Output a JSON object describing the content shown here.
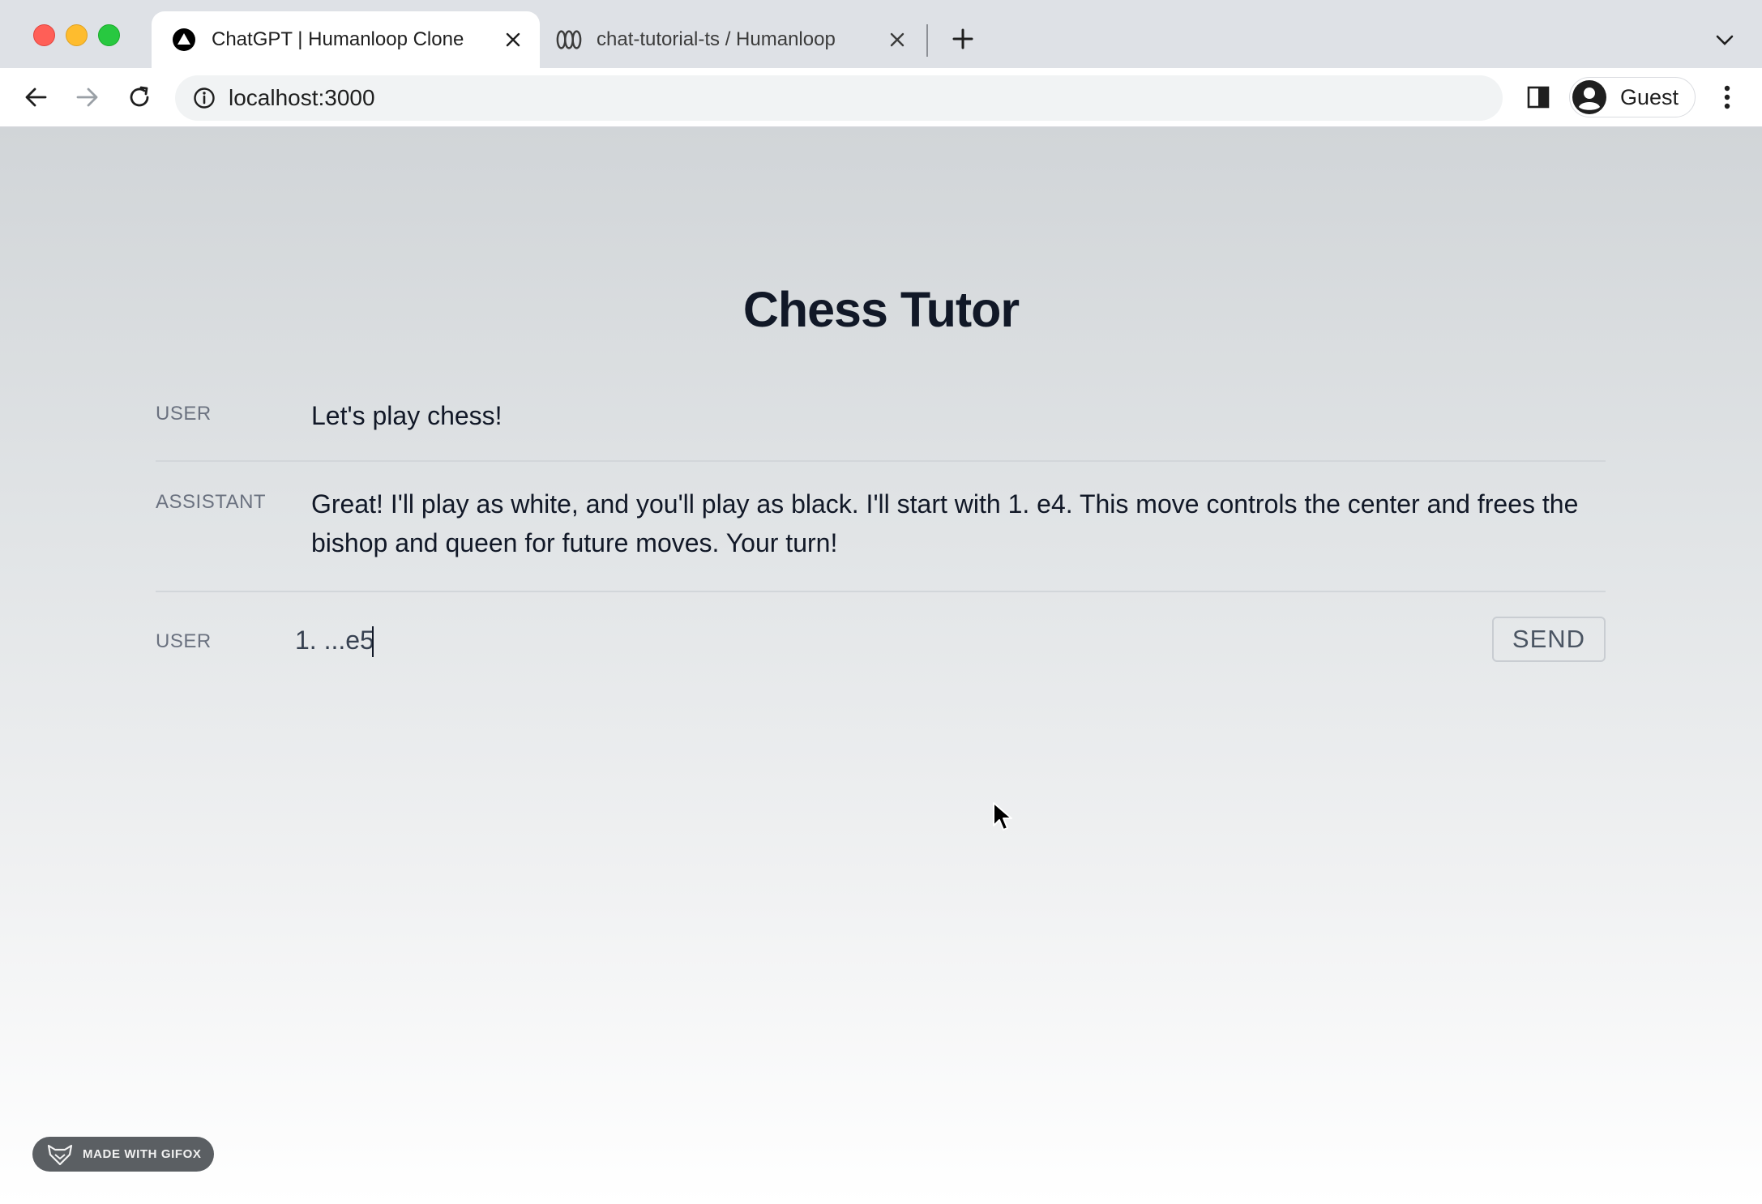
{
  "browser": {
    "tabs": [
      {
        "title": "ChatGPT | Humanloop Clone",
        "active": true,
        "icon": "triangle-logo-icon"
      },
      {
        "title": "chat-tutorial-ts / Humanloop",
        "active": false,
        "icon": "humanloop-logo-icon"
      }
    ],
    "url": "localhost:3000",
    "profile_label": "Guest"
  },
  "page": {
    "title": "Chess Tutor",
    "messages": [
      {
        "role": "USER",
        "content": "Let's play chess!"
      },
      {
        "role": "ASSISTANT",
        "content": "Great! I'll play as white, and you'll play as black. I'll start with 1. e4. This move controls the center and frees the bishop and queen for future moves. Your turn!"
      }
    ],
    "composer": {
      "role": "USER",
      "value": "1. ...e5",
      "send_label": "SEND"
    }
  },
  "badge": {
    "label": "MADE WITH GIFOX"
  },
  "colors": {
    "title": "#111827",
    "role_label": "#6b7280",
    "divider": "#d2d6da",
    "tabstrip": "#dee1e6"
  }
}
